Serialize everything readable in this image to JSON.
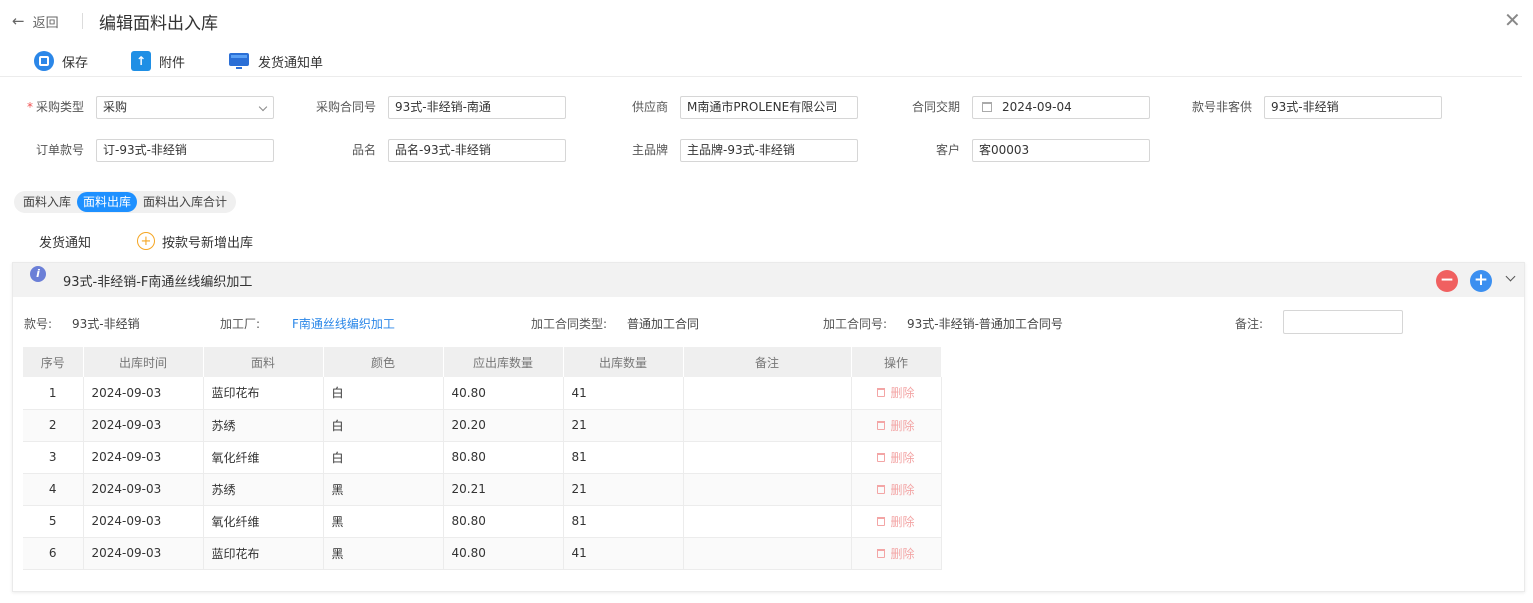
{
  "header": {
    "back_label": "返回",
    "title": "编辑面料出入库"
  },
  "toolbar": {
    "save_label": "保存",
    "attach_label": "附件",
    "notice_label": "发货通知单"
  },
  "form": {
    "purchase_type": {
      "label": "采购类型",
      "value": "采购",
      "required": true
    },
    "contract_no": {
      "label": "采购合同号",
      "value": "93式-非经销-南通"
    },
    "supplier": {
      "label": "供应商",
      "value": "M南通市PROLENE有限公司"
    },
    "delivery_date": {
      "label": "合同交期",
      "value": "2024-09-04"
    },
    "style_non_customer": {
      "label": "款号非客供",
      "value": "93式-非经销"
    },
    "order_style_no": {
      "label": "订单款号",
      "value": "订-93式-非经销"
    },
    "product_name": {
      "label": "品名",
      "value": "品名-93式-非经销"
    },
    "main_brand": {
      "label": "主品牌",
      "value": "主品牌-93式-非经销"
    },
    "customer": {
      "label": "客户",
      "value": "客00003"
    }
  },
  "tabs": [
    "面料入库",
    "面料出库",
    "面料出入库合计"
  ],
  "active_tab": 1,
  "sub_actions": {
    "ship_notice": "发货通知",
    "add_by_style": "按款号新增出库"
  },
  "card": {
    "title": "93式-非经销-F南通丝线编织加工",
    "style_label": "款号:",
    "style_value": "93式-非经销",
    "factory_label": "加工厂:",
    "factory_value": "F南通丝线编织加工",
    "contract_type_label": "加工合同类型:",
    "contract_type_value": "普通加工合同",
    "contract_no_label": "加工合同号:",
    "contract_no_value": "93式-非经销-普通加工合同号",
    "remark_label": "备注:"
  },
  "table": {
    "columns": [
      "序号",
      "出库时间",
      "面料",
      "颜色",
      "应出库数量",
      "出库数量",
      "备注",
      "操作"
    ],
    "delete_label": "删除",
    "rows": [
      [
        "1",
        "2024-09-03",
        "蓝印花布",
        "白",
        "40.80",
        "41",
        ""
      ],
      [
        "2",
        "2024-09-03",
        "苏绣",
        "白",
        "20.20",
        "21",
        ""
      ],
      [
        "3",
        "2024-09-03",
        "氧化纤维",
        "白",
        "80.80",
        "81",
        ""
      ],
      [
        "4",
        "2024-09-03",
        "苏绣",
        "黑",
        "20.21",
        "21",
        ""
      ],
      [
        "5",
        "2024-09-03",
        "氧化纤维",
        "黑",
        "80.80",
        "81",
        ""
      ],
      [
        "6",
        "2024-09-03",
        "蓝印花布",
        "黑",
        "40.80",
        "41",
        ""
      ]
    ]
  },
  "colors": {
    "accent": "#1e90ff",
    "delete": "#f3a5a5",
    "minus_button": "#f06060",
    "plus_button": "#3b8ff0"
  },
  "icons": {
    "back": "arrow-left-icon",
    "close": "close-icon",
    "save": "save-icon",
    "attach": "upload-icon",
    "notice": "monitor-icon",
    "add": "plus-circle-icon",
    "info": "info-icon",
    "delete": "trash-icon"
  }
}
